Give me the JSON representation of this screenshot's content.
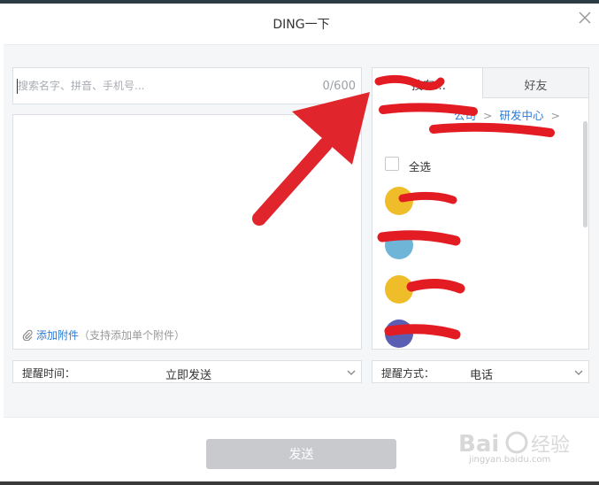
{
  "dialog": {
    "title": "DING一下"
  },
  "search": {
    "placeholder": "搜索名字、拼音、手机号...",
    "value": "",
    "counter": "0/600"
  },
  "attachment": {
    "link_label": "添加附件",
    "hint": "（支持添加单个附件）"
  },
  "reminder_time": {
    "label": "提醒时间：",
    "value": "立即发送"
  },
  "reminder_mode": {
    "label": "提醒方式：",
    "value": "电话"
  },
  "contacts_panel": {
    "tabs": [
      {
        "label": "技有…",
        "active": true
      },
      {
        "label": "好友",
        "active": false
      }
    ],
    "breadcrumb": [
      {
        "label": "公司"
      },
      {
        "label": "研发中心"
      }
    ],
    "select_all_label": "全选",
    "contacts": [
      {
        "avatar_color": "#f0bd2a"
      },
      {
        "avatar_color": "#6fb5d8"
      },
      {
        "avatar_color": "#f0bd2a"
      },
      {
        "avatar_color": "#5a5fb3"
      }
    ]
  },
  "footer": {
    "send_label": "发送"
  },
  "colors": {
    "accent_link": "#2d7bd6",
    "redaction_red": "#e31c24",
    "arrow_red": "#e0262c",
    "disabled_button": "#c8cacd"
  },
  "watermark": {
    "text": "jingyan.baidu.com"
  }
}
